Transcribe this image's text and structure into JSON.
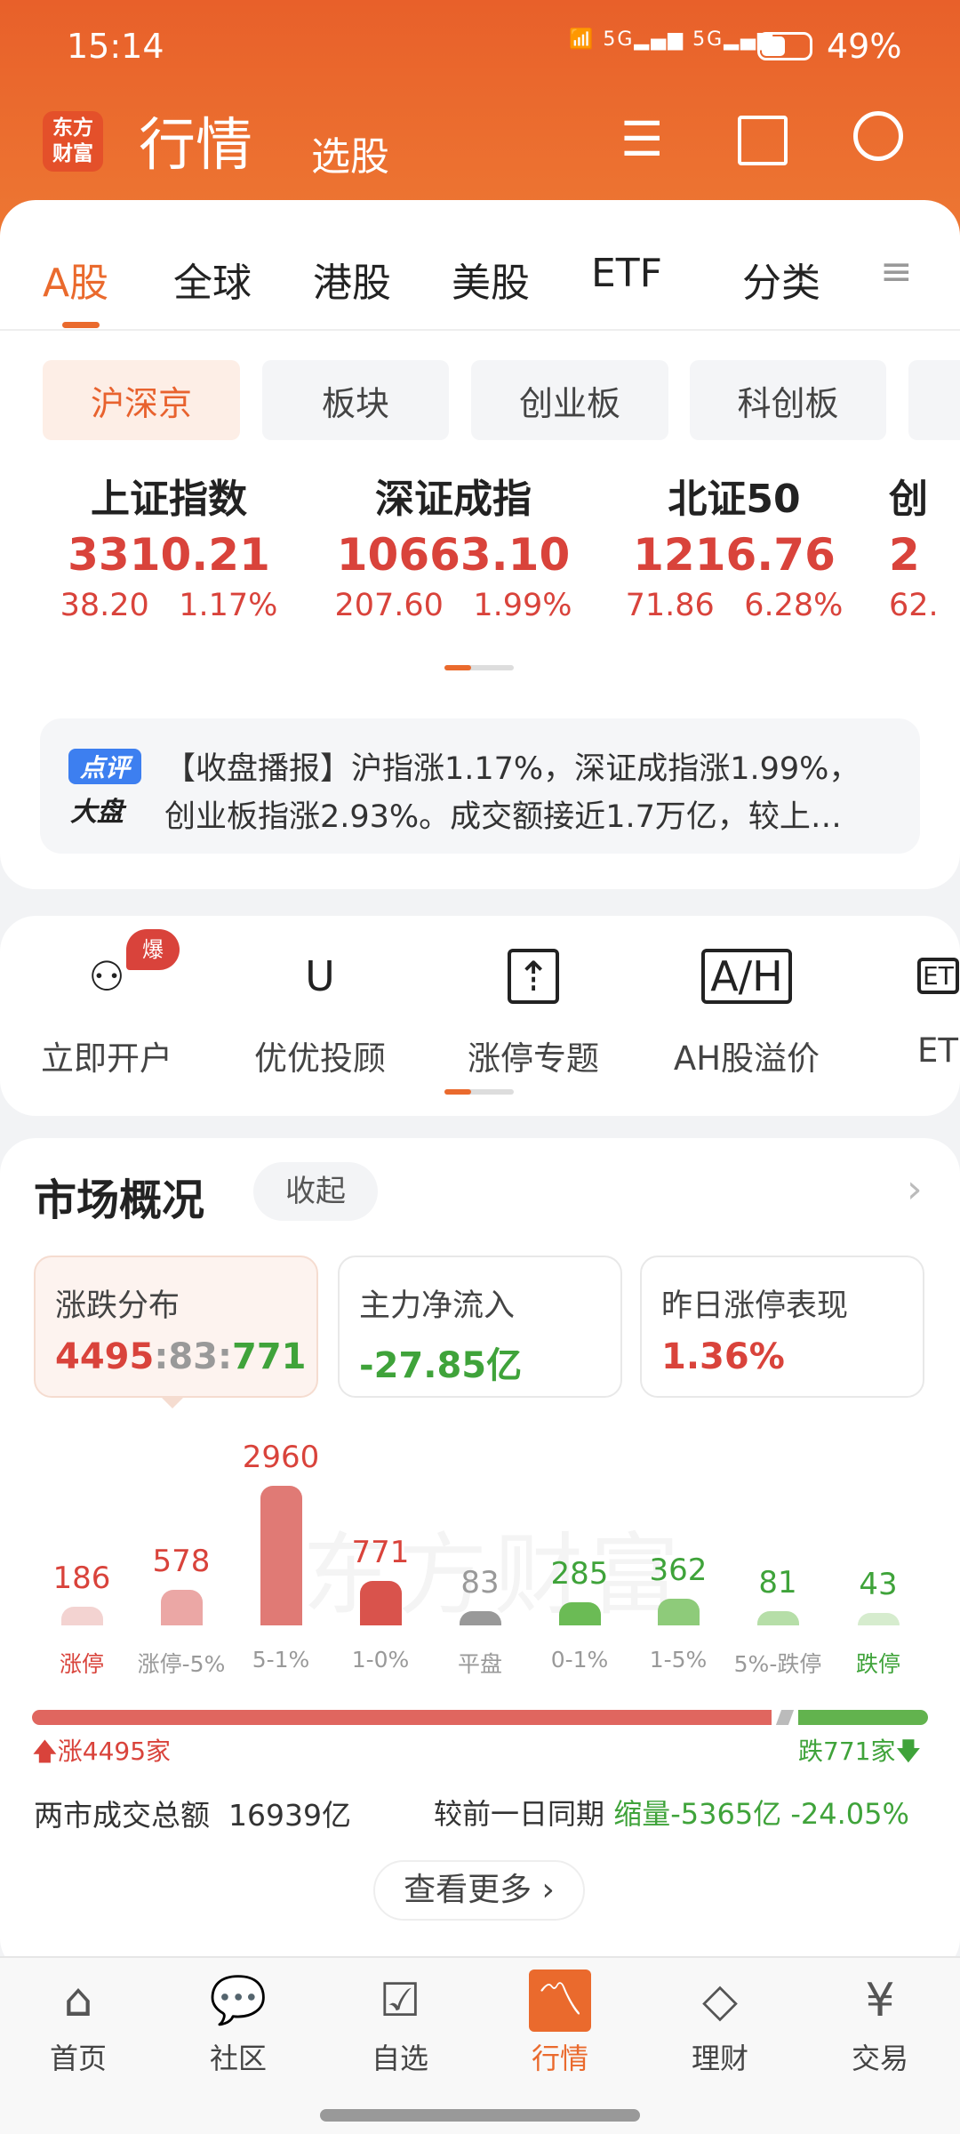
{
  "status": {
    "time": "15:14",
    "battery": "49%"
  },
  "header": {
    "logo": "东方财富",
    "title": "行情",
    "subtitle": "选股"
  },
  "tabs": [
    {
      "label": "A股",
      "active": true
    },
    {
      "label": "全球"
    },
    {
      "label": "港股"
    },
    {
      "label": "美股"
    },
    {
      "label": "ETF"
    },
    {
      "label": "分类"
    }
  ],
  "chips": [
    "沪深京",
    "板块",
    "创业板",
    "科创板"
  ],
  "indices": [
    {
      "name": "上证指数",
      "value": "3310.21",
      "change": "38.20",
      "pct": "1.17%"
    },
    {
      "name": "深证成指",
      "value": "10663.10",
      "change": "207.60",
      "pct": "1.99%"
    },
    {
      "name": "北证50",
      "value": "1216.76",
      "change": "71.86",
      "pct": "6.28%"
    },
    {
      "name": "创",
      "value": "2",
      "change": "62.",
      "pct": ""
    }
  ],
  "news": {
    "badge_top": "点评",
    "badge_bottom": "大盘",
    "line1": "【收盘播报】沪指涨1.17%，深证成指涨1.99%，",
    "line2": "创业板指涨2.93%。成交额接近1.7万亿，较上…"
  },
  "shortcuts": [
    {
      "label": "立即开户",
      "badge": "爆",
      "icon": "user-add-icon"
    },
    {
      "label": "优优投顾",
      "icon": "uu-icon"
    },
    {
      "label": "涨停专题",
      "icon": "limit-up-icon"
    },
    {
      "label": "AH股溢价",
      "icon": "ah-icon"
    },
    {
      "label": "ET",
      "icon": "etf-icon"
    }
  ],
  "market": {
    "title": "市场概况",
    "collapse": "收起",
    "tiles": [
      {
        "label": "涨跌分布",
        "up": "4495",
        "flat": "83",
        "down": "771"
      },
      {
        "label": "主力净流入",
        "value": "-27.85亿"
      },
      {
        "label": "昨日涨停表现",
        "value": "1.36%"
      }
    ],
    "up_label": "涨4495家",
    "down_label": "跌771家",
    "turnover_label": "两市成交总额",
    "turnover": "16939亿",
    "compare_label": "较前一日同期",
    "compare": "缩量-5365亿",
    "compare_pct": "-24.05%",
    "more": "查看更多",
    "watermark": "东方财富"
  },
  "chart_data": {
    "type": "bar",
    "categories": [
      "涨停",
      "涨停-5%",
      "5-1%",
      "1-0%",
      "平盘",
      "0-1%",
      "1-5%",
      "5%-跌停",
      "跌停"
    ],
    "values": [
      186,
      578,
      2960,
      771,
      83,
      285,
      362,
      81,
      43
    ],
    "colors": [
      "#f3d3d1",
      "#eba7a5",
      "#e07a75",
      "#d9534c",
      "#999999",
      "#6bbb55",
      "#8ecb7a",
      "#b6dea8",
      "#d6ecce"
    ],
    "label_colors": [
      "#d9433b",
      "#d9433b",
      "#d9433b",
      "#d9433b",
      "#999999",
      "#3fa33a",
      "#3fa33a",
      "#3fa33a",
      "#3fa33a"
    ],
    "tick_colors": [
      "#d9433b",
      "#999",
      "#999",
      "#999",
      "#999",
      "#999",
      "#999",
      "#999",
      "#3fa33a"
    ]
  },
  "nav": [
    {
      "label": "首页"
    },
    {
      "label": "社区"
    },
    {
      "label": "自选"
    },
    {
      "label": "行情",
      "active": true
    },
    {
      "label": "理财"
    },
    {
      "label": "交易"
    }
  ],
  "colors": {
    "accent": "#ea6a2d",
    "up": "#d9433b",
    "down": "#3fa33a"
  }
}
